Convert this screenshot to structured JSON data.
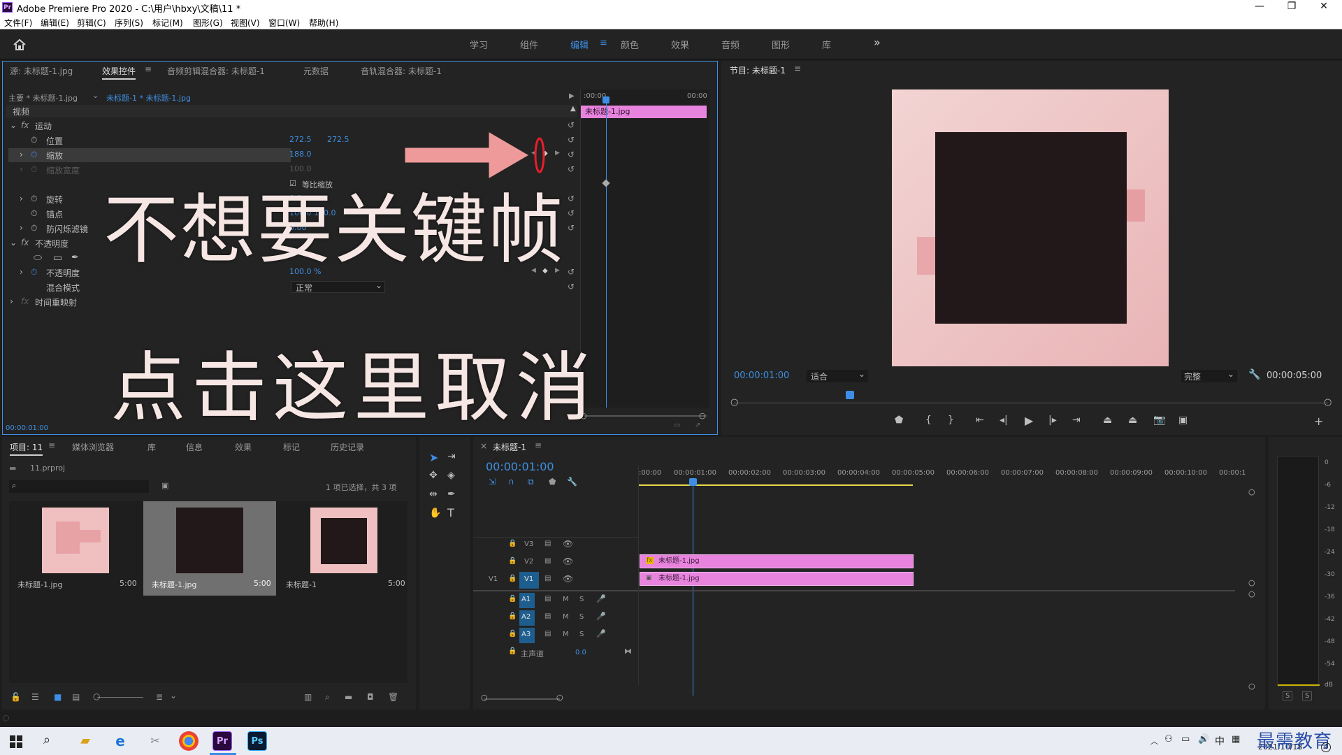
{
  "window": {
    "app_icon": "Pr",
    "title": "Adobe Premiere Pro 2020 - C:\\用户\\hbxy\\文稿\\11 *",
    "controls": {
      "minimize": "—",
      "restore": "❐",
      "close": "✕"
    }
  },
  "menu": [
    "文件(F)",
    "编辑(E)",
    "剪辑(C)",
    "序列(S)",
    "标记(M)",
    "图形(G)",
    "视图(V)",
    "窗口(W)",
    "帮助(H)"
  ],
  "workspaces": {
    "items": [
      "学习",
      "组件",
      "编辑",
      "颜色",
      "效果",
      "音频",
      "图形",
      "库"
    ],
    "active": "编辑",
    "more": "»"
  },
  "effect_panel": {
    "tabs": [
      "源: 未标题-1.jpg",
      "效果控件",
      "音频剪辑混合器: 未标题-1",
      "元数据",
      "音轨混合器: 未标题-1"
    ],
    "active_tab": "效果控件",
    "master_label": "主要 * 未标题-1.jpg",
    "clip_label": "未标题-1 * 未标题-1.jpg",
    "mini_timeline": {
      "start": ":00:00",
      "end": "00:00",
      "clip": "未标题-1.jpg"
    },
    "section_video": "视频",
    "motion": "运动",
    "position": {
      "label": "位置",
      "x": "272.5",
      "y": "272.5"
    },
    "scale": {
      "label": "缩放",
      "value": "188.0"
    },
    "scale_width": {
      "label": "缩放宽度",
      "value": "100.0"
    },
    "uniform_scale": "等比缩放",
    "rotation": {
      "label": "旋转",
      "value": "0.0"
    },
    "anchor": {
      "label": "锚点",
      "value": "100.0    100.0"
    },
    "anti_flicker": {
      "label": "防闪烁滤镜",
      "value": "0.00"
    },
    "opacity_section": "不透明度",
    "opacity": {
      "label": "不透明度",
      "value": "100.0 %"
    },
    "blend_mode": {
      "label": "混合模式",
      "value": "正常"
    },
    "time_remap": "时间重映射",
    "timecode": "00:00:01:00"
  },
  "overlay": {
    "line1": "不想要关键帧",
    "line2": "点击这里取消"
  },
  "program": {
    "title": "节目: 未标题-1",
    "timecode": "00:00:01:00",
    "fit": "适合",
    "quality": "完整",
    "duration": "00:00:05:00"
  },
  "project": {
    "tabs": [
      "项目: 11",
      "媒体浏览器",
      "库",
      "信息",
      "效果",
      "标记",
      "历史记录"
    ],
    "active_tab": "项目: 11",
    "file": "11.prproj",
    "selection_info": "1 项已选择，共 3 项",
    "items": [
      {
        "name": "未标题-1.jpg",
        "duration": "5:00"
      },
      {
        "name": "未标题-1.jpg",
        "duration": "5:00"
      },
      {
        "name": "未标题-1",
        "duration": "5:00"
      }
    ]
  },
  "sequence": {
    "tab": "未标题-1",
    "timecode": "00:00:01:00",
    "ruler": [
      ":00:00",
      "00:00:01:00",
      "00:00:02:00",
      "00:00:03:00",
      "00:00:04:00",
      "00:00:05:00",
      "00:00:06:00",
      "00:00:07:00",
      "00:00:08:00",
      "00:00:09:00",
      "00:00:10:00",
      "00:00:1"
    ],
    "tracks": {
      "v3": "V3",
      "v2": "V2",
      "v1": "V1",
      "v1_src": "V1",
      "a1": "A1",
      "a2": "A2",
      "a3": "A3",
      "mute": "M",
      "solo": "S",
      "master": "主声道",
      "master_value": "0.0"
    },
    "clip_v2": "未标题-1.jpg",
    "clip_v1": "未标题-1.jpg"
  },
  "meter": {
    "labels": [
      "0",
      "-6",
      "-12",
      "-18",
      "-24",
      "-30",
      "-36",
      "-42",
      "-48",
      "-54",
      "dB"
    ],
    "solo": "S"
  },
  "taskbar": {
    "ime": "中",
    "date": "2021/10/18",
    "watermark": "最需教育"
  },
  "colors": {
    "accent": "#3d8ee6",
    "clip": "#e884dd",
    "canvas_light": "#f0c8c8",
    "canvas_dark": "#221819",
    "keyframe_circle": "#e81e2a",
    "arrow": "#ef9a9a"
  }
}
